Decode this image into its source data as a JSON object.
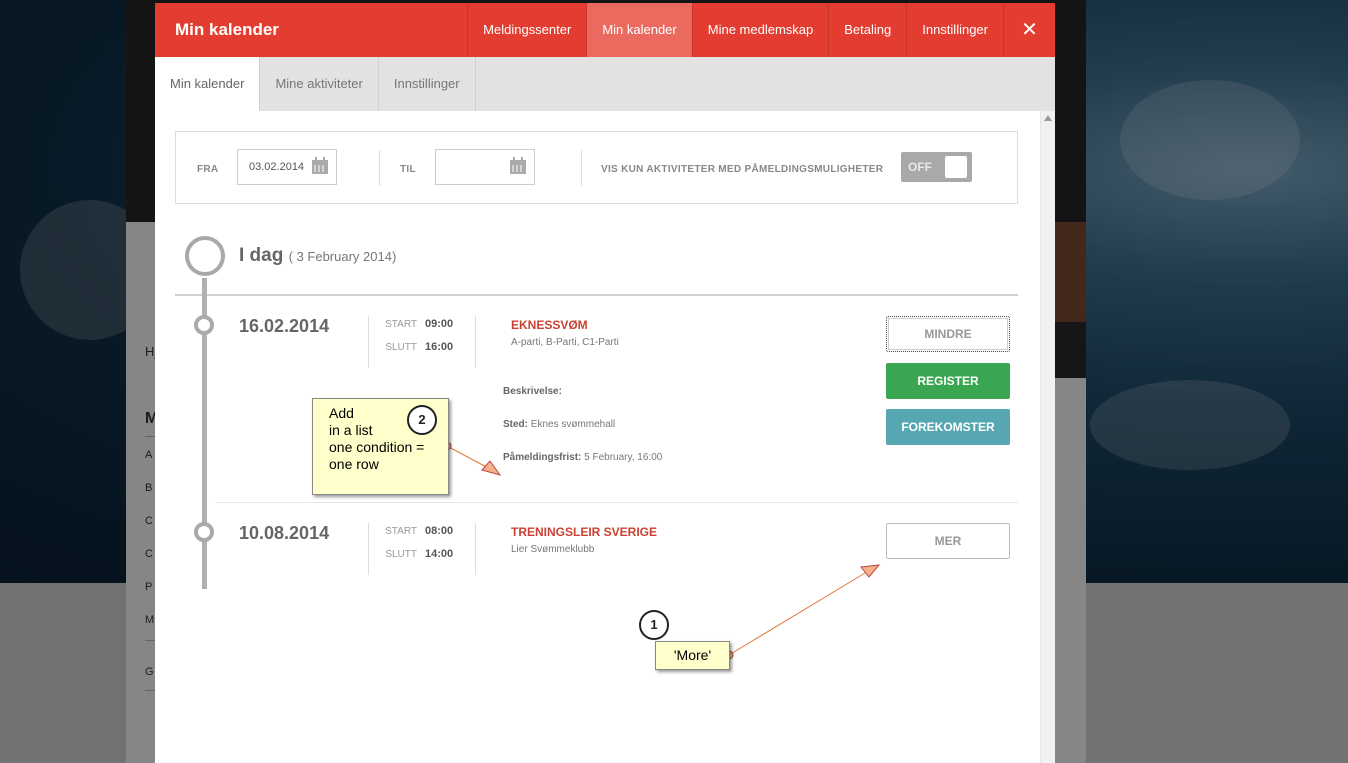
{
  "background": {
    "side_texts": [
      "Hj",
      "M",
      "A",
      "B",
      "C",
      "C",
      "P",
      "M",
      "G"
    ]
  },
  "modal": {
    "title": "Min kalender",
    "top_nav": [
      "Meldingssenter",
      "Min kalender",
      "Mine medlemskap",
      "Betaling",
      "Innstillinger"
    ],
    "top_nav_active": "Min kalender",
    "close_symbol": "✕",
    "sub_tabs": [
      "Min kalender",
      "Mine aktiviteter",
      "Innstillinger"
    ],
    "sub_tab_active": "Min kalender"
  },
  "filter": {
    "from_label": "FRA",
    "from_value": "03.02.2014",
    "to_label": "TIL",
    "to_value": "",
    "only_signup_label": "VIS KUN AKTIVITETER MED PÅMELDINGSMULIGHETER",
    "toggle_state": "OFF"
  },
  "today": {
    "label": "I dag",
    "date": "( 3 February 2014)"
  },
  "events": [
    {
      "date": "16.02.2014",
      "start_label": "START",
      "start": "09:00",
      "end_label": "SLUTT",
      "end": "16:00",
      "name": "EKNESSVØM",
      "groups": "A-parti, B-Parti, C1-Parti",
      "description_label": "Beskrivelse:",
      "place_label": "Sted:",
      "place": "Eknes svømmehall",
      "deadline_label": "Påmeldingsfrist:",
      "deadline": "5 February, 16:00",
      "buttons": {
        "less": "MINDRE",
        "register": "REGISTER",
        "occurrences": "FOREKOMSTER"
      }
    },
    {
      "date": "10.08.2014",
      "start_label": "START",
      "start": "08:00",
      "end_label": "SLUTT",
      "end": "14:00",
      "name": "TRENINGSLEIR SVERIGE",
      "groups": "Lier Svømmeklubb",
      "buttons": {
        "more": "MER"
      }
    }
  ],
  "annotations": [
    {
      "number": "1",
      "text": "'More'"
    },
    {
      "number": "2",
      "lines": [
        "Add",
        "in a list",
        "one condition =",
        "one row"
      ]
    }
  ],
  "colors": {
    "brand_red": "#e23d30",
    "register_green": "#3aa652",
    "occurrences_teal": "#56a7b1",
    "event_name_red": "#c94233",
    "note_yellow": "#ffffcc"
  }
}
